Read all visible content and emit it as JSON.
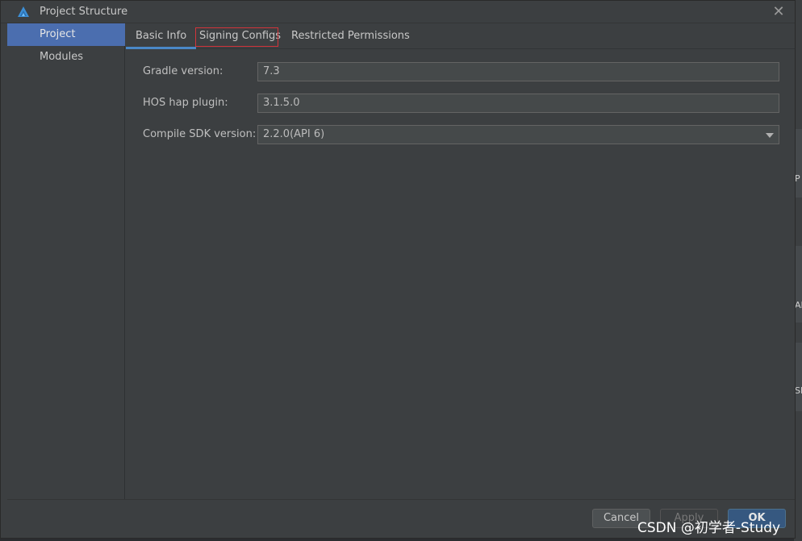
{
  "window": {
    "title": "Project Structure",
    "close_symbol": "✕"
  },
  "sidebar": {
    "items": [
      {
        "label": "Project",
        "selected": true
      },
      {
        "label": "Modules",
        "selected": false
      }
    ]
  },
  "tabs": [
    {
      "label": "Basic Info",
      "active": true
    },
    {
      "label": "Signing Configs",
      "highlighted": true
    },
    {
      "label": "Restricted Permissions"
    }
  ],
  "form": {
    "gradle_version": {
      "label": "Gradle version:",
      "value": "7.3"
    },
    "hos_hap_plugin": {
      "label": "HOS hap plugin:",
      "value": "3.1.5.0"
    },
    "compile_sdk_version": {
      "label": "Compile SDK version:",
      "value": "2.2.0(API 6)"
    }
  },
  "footer": {
    "cancel": "Cancel",
    "apply": "Apply",
    "ok": "OK"
  },
  "backdrop": {
    "fragments": [
      "P",
      "AF",
      "SI"
    ]
  },
  "watermark": "CSDN @初学者-Study",
  "colors": {
    "accent": "#4b6eaf",
    "highlight_border": "#d2343a",
    "tab_underline": "#4a88c7"
  }
}
